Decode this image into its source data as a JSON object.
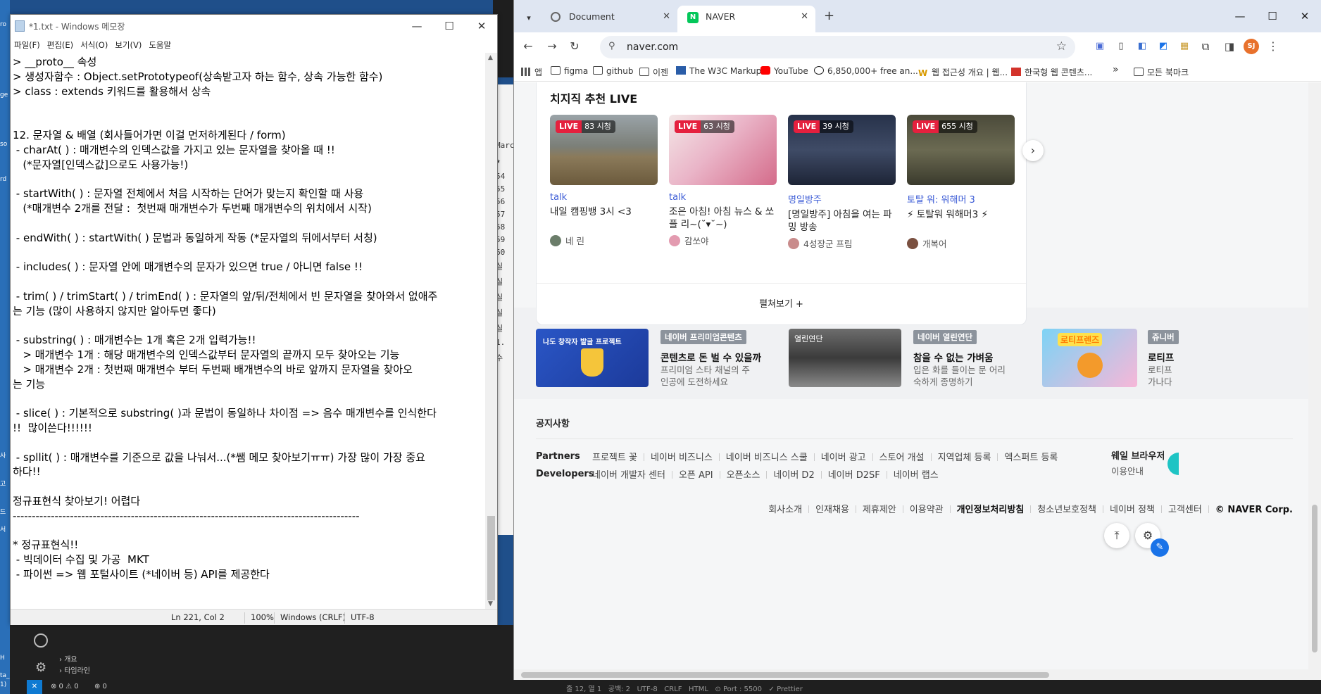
{
  "desktop": {
    "labels": [
      "ro",
      "ge",
      "so",
      "rd",
      "사",
      "고",
      "드",
      "서",
      "H",
      "ta_C",
      "1)"
    ]
  },
  "vscode": {
    "side_rows": [
      "Marc",
      "★",
      "54",
      "55",
      "56",
      "57",
      "58",
      "59",
      "60",
      "실",
      "실",
      "실",
      "실",
      "실",
      "1.",
      "수"
    ],
    "tree": [
      "개요",
      "타임라인"
    ],
    "status": [
      "⊗ 0 ⚠ 0",
      "⊕ 0"
    ],
    "status_right": "줄 12, 열 1   공백: 2   UTF-8   CRLF   HTML   ⊙ Port : 5500   ✓ Prettier"
  },
  "notepad": {
    "title": "*1.txt - Windows 메모장",
    "menu": [
      "파일(F)",
      "편집(E)",
      "서식(O)",
      "보기(V)",
      "도움말"
    ],
    "lines": [
      "> __proto__ 속성",
      "> 생성자함수 : Object.setPrototypeof(상속받고자 하는 함수, 상속 가능한 함수)",
      "> class : extends 키워드를 활용해서 상속",
      "",
      "",
      "12. 문자열 & 배열 (회사들어가면 이걸 먼저하게된다 / form)",
      " - charAt( ) : 매개변수의 인덱스값을 가지고 있는 문자열을 찾아올 때 !!",
      "   (*문자열[인덱스값]으로도 사용가능!)",
      "",
      " - startWith( ) : 문자열 전체에서 처음 시작하는 단어가 맞는지 확인할 때 사용",
      "   (*매개변수 2개를 전달 :  첫번째 매개변수가 두번째 매개변수의 위치에서 시작)",
      "",
      " - endWith( ) : startWith( ) 문법과 동일하게 작동 (*문자열의 뒤에서부터 서칭)",
      "",
      " - includes( ) : 문자열 안에 매개변수의 문자가 있으면 true / 아니면 false !!",
      "",
      " - trim( ) / trimStart( ) / trimEnd( ) : 문자열의 앞/뒤/전체에서 빈 문자열을 찾아와서 없애주",
      "는 기능 (많이 사용하지 않지만 알아두면 좋다)",
      "",
      " - substring( ) : 매개변수는 1개 혹은 2개 입력가능!!",
      "   > 매개변수 1개 : 해당 매개변수의 인덱스값부터 문자열의 끝까지 모두 찾아오는 기능",
      "   > 매개변수 2개 : 첫번째 매개변수 부터 두번째 배개변수의 바로 앞까지 문자열을 찾아오",
      "는 기능",
      "",
      " - slice( ) : 기본적으로 substring( )과 문법이 동일하나 차이점 => 음수 매개변수를 인식한다",
      "!!  많이쓴다!!!!!!",
      "",
      " - spllit( ) : 매개변수를 기준으로 값을 나눠서...(*쌤 메모 찾아보기ㅠㅠ) 가장 많이 가장 중요",
      "하다!!",
      "",
      "정규표현식 찾아보기! 어렵다",
      "-------------------------------------------------------------------------------------------",
      "",
      "* 정규표현식!!",
      " - 빅데이터 수집 및 가공  MKT",
      " - 파이썬 => 웹 포털사이트 (*네이버 등) API를 제공한다"
    ],
    "status": {
      "position": "Ln 221, Col 2",
      "zoom": "100%",
      "eol": "Windows (CRLF)",
      "encoding": "UTF-8"
    }
  },
  "chrome": {
    "tabs": [
      {
        "label": "Document",
        "active": false
      },
      {
        "label": "NAVER",
        "active": true
      }
    ],
    "url": "naver.com",
    "profile_initials": "SJ",
    "bookmarks": [
      "앱",
      "figma",
      "github",
      "이젠",
      "The W3C Markup...",
      "YouTube",
      "6,850,000+ free an...",
      "웹 접근성 개요 | 웹...",
      "한국형 웹 콘텐츠...",
      "»",
      "모든 북마크"
    ]
  },
  "naver": {
    "live_title": "치지직 추천 LIVE",
    "live_items": [
      {
        "viewers": "83 시청",
        "channel": "talk",
        "title": "내일 캠핑뱅 3시 <3",
        "streamer": "네 린"
      },
      {
        "viewers": "63 시청",
        "channel": "talk",
        "title": "조은 아침! 아침 뉴스 & 쏘플 리~(˘▾˘~)",
        "streamer": "감쏘야"
      },
      {
        "viewers": "39 시청",
        "channel": "명일방주",
        "title": "[명일방주] 아침을 여는 파밍 방송",
        "streamer": "4성장군 프림"
      },
      {
        "viewers": "655 시청",
        "channel": "토탈 워: 워해머 3",
        "title": "⚡ 토탈워 워해머3 ⚡",
        "streamer": "개복어"
      }
    ],
    "live_badge": "LIVE",
    "more_label": "펼쳐보기 +",
    "promos": [
      {
        "img_text": "나도 창작자 발굴 프로젝트",
        "tag": "네이버 프리미엄콘텐츠",
        "headline": "콘텐츠로 돈 벌 수 있을까",
        "desc": "프리미엄 스타 채널의 주인공에 도전하세요"
      },
      {
        "img_text": "열린연단",
        "tag": "네이버 열린연단",
        "headline": "참을 수 없는 가벼움",
        "desc": "입은 화를 들이는 문 어리숙하게 종명하기"
      },
      {
        "img_text": "로티프렌즈",
        "tag": "쥬니버",
        "headline": "로티프",
        "desc": "로티프 가나다"
      }
    ],
    "notice": "공지사항",
    "partners_label": "Partners",
    "partners": [
      "프로젝트 꽃",
      "네이버 비즈니스",
      "네이버 비즈니스 스쿨",
      "네이버 광고",
      "스토어 개설",
      "지역업체 등록",
      "엑스퍼트 등록"
    ],
    "developers_label": "Developers",
    "developers": [
      "네이버 개발자 센터",
      "오픈 API",
      "오픈소스",
      "네이버 D2",
      "네이버 D2SF",
      "네이버 랩스"
    ],
    "whale": "웨일 브라우저",
    "whale_sub": "이용안내",
    "corp_links": [
      "회사소개",
      "인재채용",
      "제휴제안",
      "이용약관",
      "개인정보처리방침",
      "청소년보호정책",
      "네이버 정책",
      "고객센터"
    ],
    "corp_name": "© NAVER Corp."
  },
  "colors": {
    "naver_green": "#03c75a",
    "live_red": "#e5203e",
    "chzzk_blue": "#3b5bd6"
  }
}
